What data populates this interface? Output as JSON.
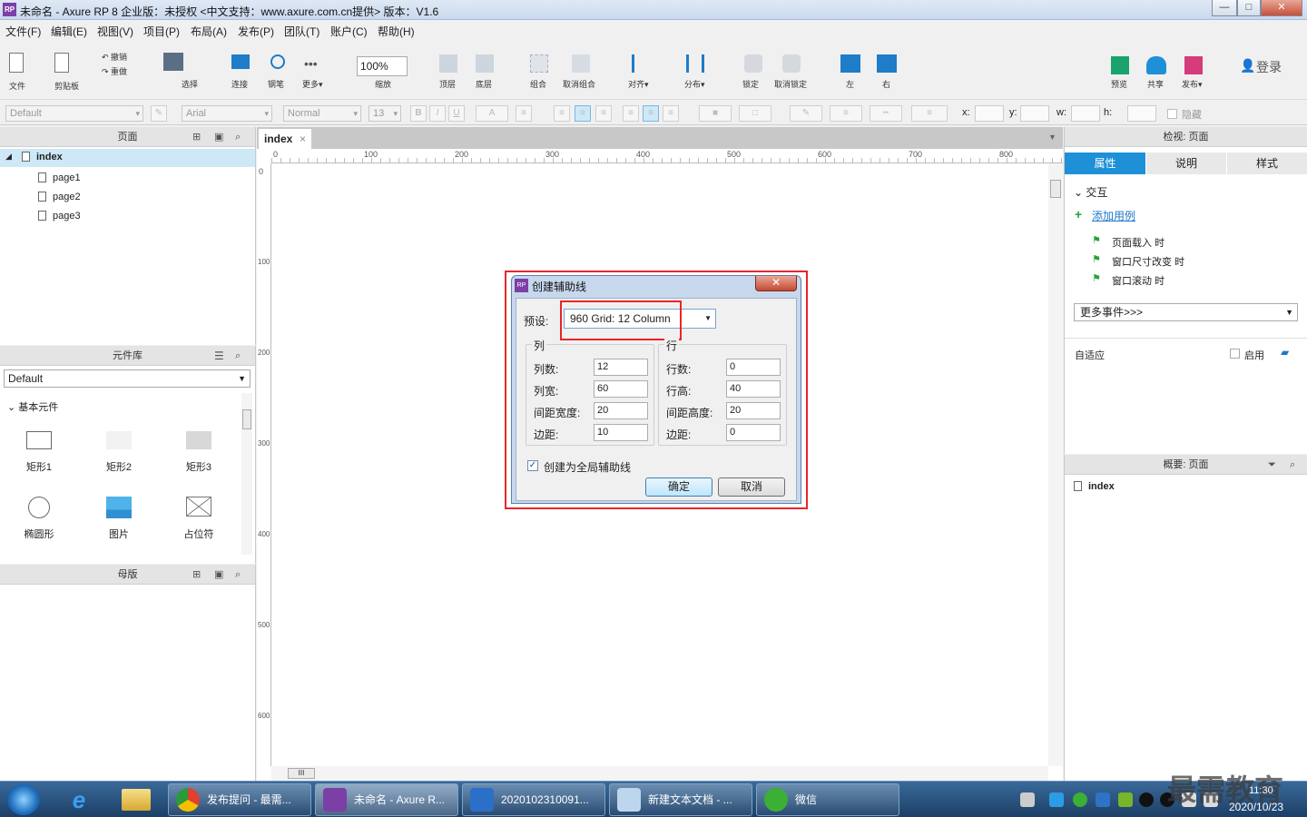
{
  "window": {
    "title": "未命名 - Axure RP 8 企业版：未授权    <中文支持：www.axure.com.cn提供> 版本：V1.6",
    "icon": "RP",
    "min": "—",
    "max": "□",
    "close": "✕"
  },
  "menu": [
    "文件(F)",
    "编辑(E)",
    "视图(V)",
    "项目(P)",
    "布局(A)",
    "发布(P)",
    "团队(T)",
    "账户(C)",
    "帮助(H)"
  ],
  "toolbar": {
    "file": "文件",
    "clipboard": "剪贴板",
    "undo": "撤销",
    "redo": "重做",
    "select": "选择",
    "connect": "连接",
    "pen": "钢笔",
    "more": "更多▾",
    "zoom": "100%",
    "zoom_label": "缩放",
    "top": "顶层",
    "bottom": "底层",
    "group": "组合",
    "ungroup": "取消组合",
    "align": "对齐▾",
    "distribute": "分布▾",
    "lock": "锁定",
    "unlock": "取消锁定",
    "left": "左",
    "right": "右",
    "preview": "预览",
    "share": "共享",
    "publish": "发布▾",
    "login": "登录"
  },
  "format": {
    "style": "Default",
    "font": "Arial",
    "weight": "Normal",
    "size": "13",
    "bold": "B",
    "italic": "I",
    "underline": "U",
    "text_color": "A",
    "x": "x:",
    "y": "y:",
    "w": "w:",
    "h": "h:",
    "hidden": "隐藏"
  },
  "pages": {
    "title": "页面",
    "items": [
      "index",
      "page1",
      "page2",
      "page3"
    ]
  },
  "library": {
    "title": "元件库",
    "selected": "Default",
    "section": "基本元件",
    "widgets": [
      "矩形1",
      "矩形2",
      "矩形3",
      "椭圆形",
      "图片",
      "占位符"
    ]
  },
  "masters": {
    "title": "母版"
  },
  "canvas": {
    "tab": "index",
    "tab_close": "×",
    "ruler_h": [
      "0",
      "100",
      "200",
      "300",
      "400",
      "500",
      "600",
      "700",
      "800"
    ],
    "ruler_v": [
      "0",
      "100",
      "200",
      "300",
      "400",
      "500",
      "600"
    ],
    "scroll_grip": "III"
  },
  "dialog": {
    "title": "创建辅助线",
    "icon": "RP",
    "close": "✕",
    "preset_label": "预设:",
    "preset_value": "960 Grid: 12 Column",
    "col_group": "列",
    "row_group": "行",
    "cols": [
      {
        "label": "列数:",
        "value": "12"
      },
      {
        "label": "列宽:",
        "value": "60"
      },
      {
        "label": "间距宽度:",
        "value": "20"
      },
      {
        "label": "边距:",
        "value": "10"
      }
    ],
    "rows": [
      {
        "label": "行数:",
        "value": "0"
      },
      {
        "label": "行高:",
        "value": "40"
      },
      {
        "label": "间距高度:",
        "value": "20"
      },
      {
        "label": "边距:",
        "value": "0"
      }
    ],
    "global_check": "创建为全局辅助线",
    "ok": "确定",
    "cancel": "取消"
  },
  "inspector": {
    "title": "检视: 页面",
    "tabs": [
      "属性",
      "说明",
      "样式"
    ],
    "interaction": "交互",
    "add_case": "添加用例",
    "events": [
      "页面载入 时",
      "窗口尺寸改变 时",
      "窗口滚动 时"
    ],
    "more_events": "更多事件>>>",
    "adaptive": "自适应",
    "enable": "启用"
  },
  "outline": {
    "title": "概要: 页面",
    "item": "index"
  },
  "taskbar": {
    "items": [
      "发布提问 - 最需...",
      "未命名 - Axure R...",
      "2020102310091...",
      "新建文本文档 - ...",
      "微信"
    ],
    "time": "11:30",
    "date": "2020/10/23",
    "watermark": "最需教育"
  },
  "colors": {
    "accent": "#1e90d8",
    "highlight": "#e8262a",
    "selection": "#cde8f7"
  }
}
